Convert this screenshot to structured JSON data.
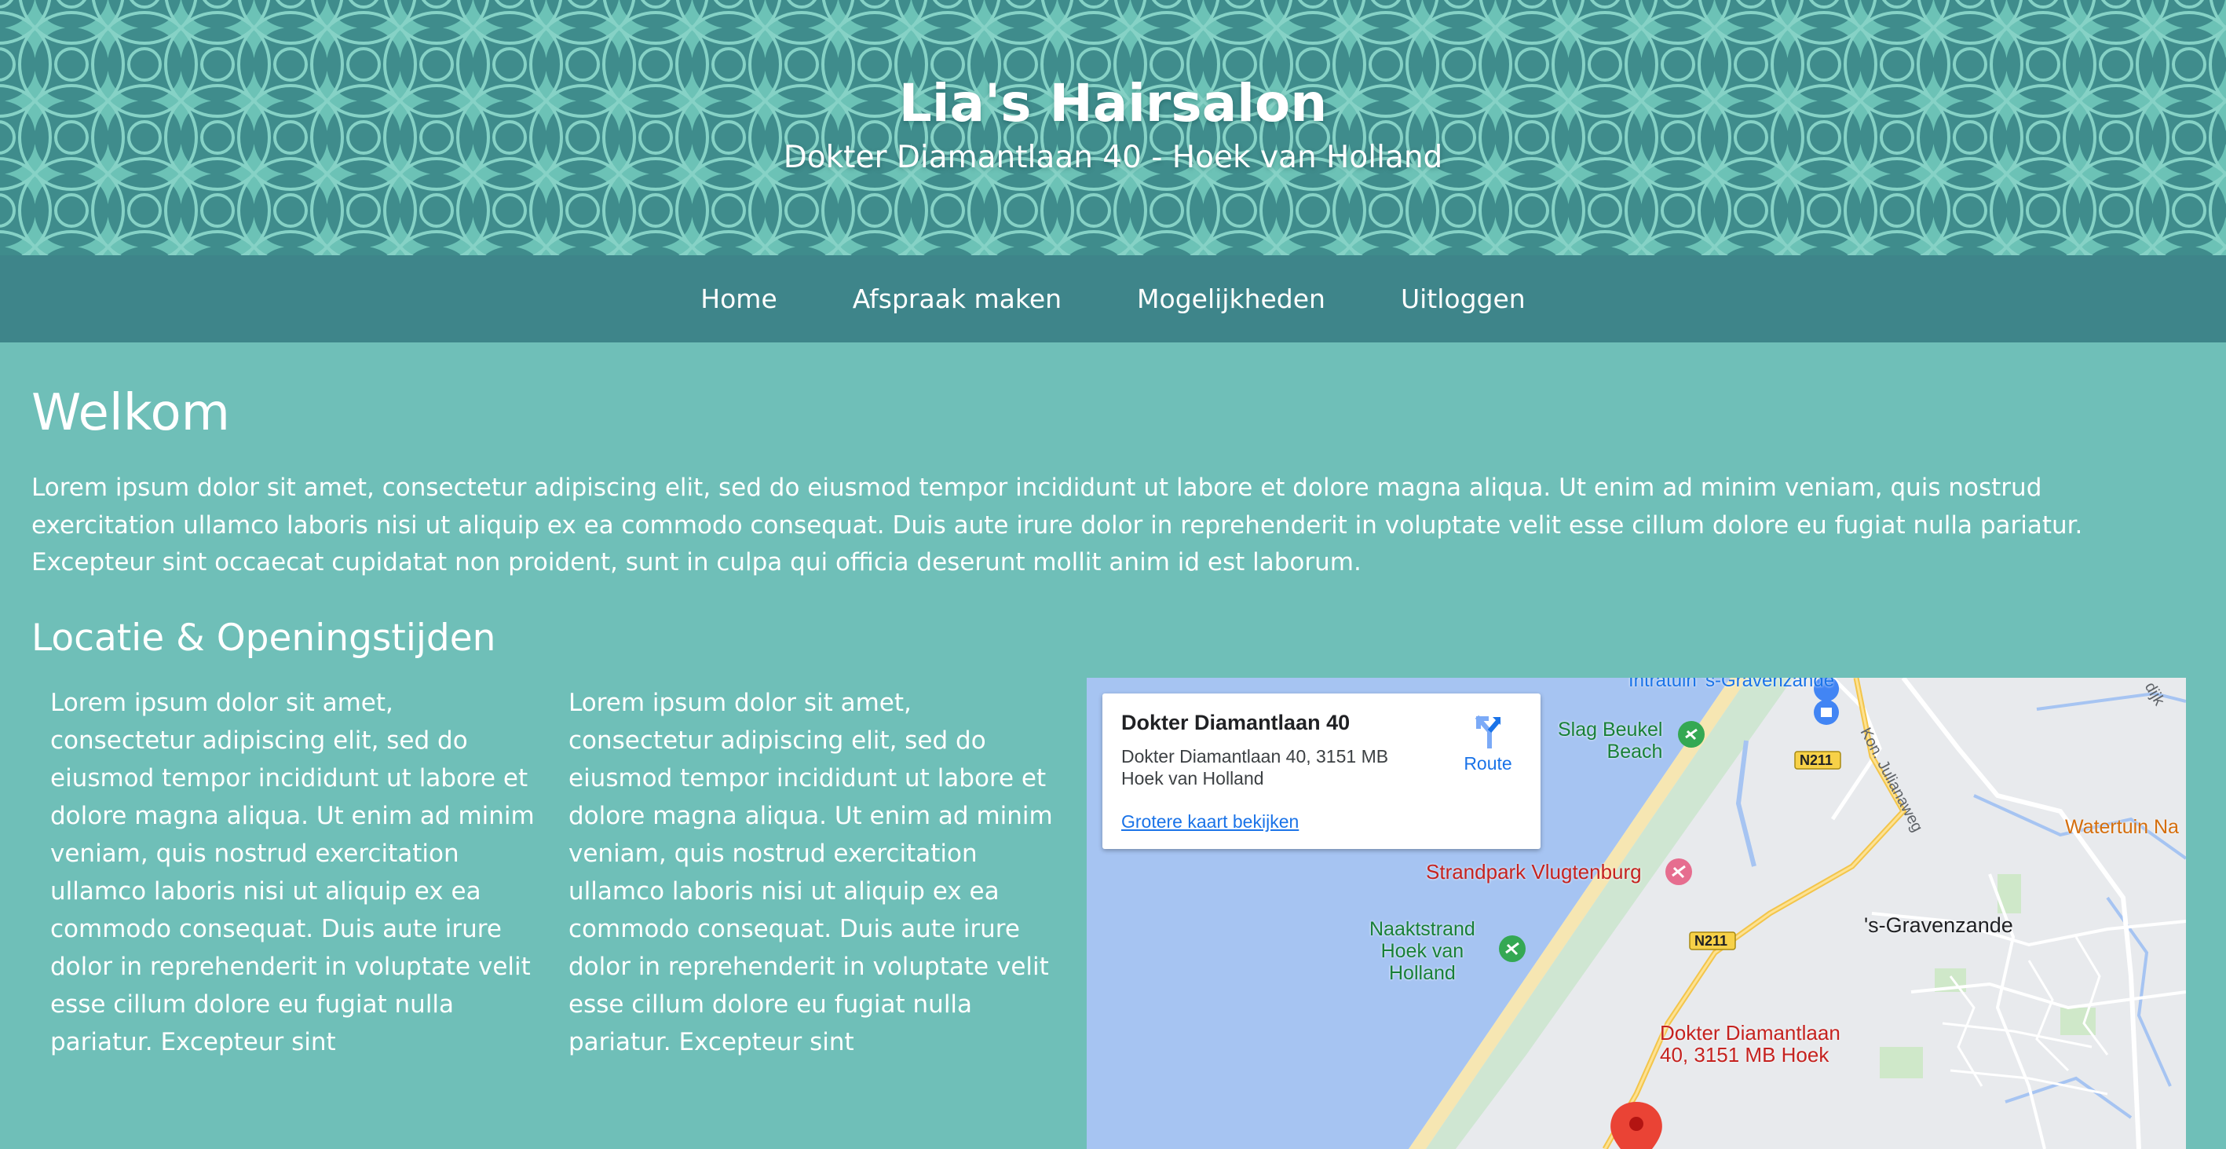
{
  "header": {
    "title": "Lia's Hairsalon",
    "subtitle": "Dokter Diamantlaan 40 - Hoek van Holland"
  },
  "nav": {
    "items": [
      {
        "label": "Home"
      },
      {
        "label": "Afspraak maken"
      },
      {
        "label": "Mogelijkheden"
      },
      {
        "label": "Uitloggen"
      }
    ]
  },
  "welcome": {
    "title": "Welkom",
    "text": "Lorem ipsum dolor sit amet, consectetur adipiscing elit, sed do eiusmod tempor incididunt ut labore et dolore magna aliqua. Ut enim ad minim veniam, quis nostrud exercitation ullamco laboris nisi ut aliquip ex ea commodo consequat. Duis aute irure dolor in reprehenderit in voluptate velit esse cillum dolore eu fugiat nulla pariatur. Excepteur sint occaecat cupidatat non proident, sunt in culpa qui officia deserunt mollit anim id est laborum."
  },
  "location": {
    "title": "Locatie & Openingstijden",
    "col1": "Lorem ipsum dolor sit amet, consectetur adipiscing elit, sed do eiusmod tempor incididunt ut labore et dolore magna aliqua. Ut enim ad minim veniam, quis nostrud exercitation ullamco laboris nisi ut aliquip ex ea commodo consequat. Duis aute irure dolor in reprehenderit in voluptate velit esse cillum dolore eu fugiat nulla pariatur. Excepteur sint",
    "col2": "Lorem ipsum dolor sit amet, consectetur adipiscing elit, sed do eiusmod tempor incididunt ut labore et dolore magna aliqua. Ut enim ad minim veniam, quis nostrud exercitation ullamco laboris nisi ut aliquip ex ea commodo consequat. Duis aute irure dolor in reprehenderit in voluptate velit esse cillum dolore eu fugiat nulla pariatur. Excepteur sint"
  },
  "map": {
    "card_title": "Dokter Diamantlaan 40",
    "card_address": "Dokter Diamantlaan 40, 3151 MB Hoek van Holland",
    "route_label": "Route",
    "larger_map_link": "Grotere kaart bekijken",
    "labels": {
      "intratuin": "Intratuin 's-Gravenzande",
      "slag_beukel": "Slag Beukel\nBeach",
      "strandpark": "Strandpark Vlugtenburg",
      "naaktstrand": "Naaktstrand\nHoek van\nHolland",
      "gravenzande": "'s-Gravenzande",
      "watertuin": "Watertuin Na",
      "julianaweg": "Kon. Julianaweg",
      "road_n211_a": "N211",
      "road_n211_b": "N211",
      "marker_label": "Dokter Diamantlaan\n40, 3151 MB Hoek",
      "dijk": "dijk"
    }
  },
  "colors": {
    "page_bg": "#6fbfb8",
    "nav_bg": "#3e858a",
    "header_bg": "#3f8c8c",
    "map_water": "#a6c4f2",
    "map_link": "#1a73e8"
  }
}
